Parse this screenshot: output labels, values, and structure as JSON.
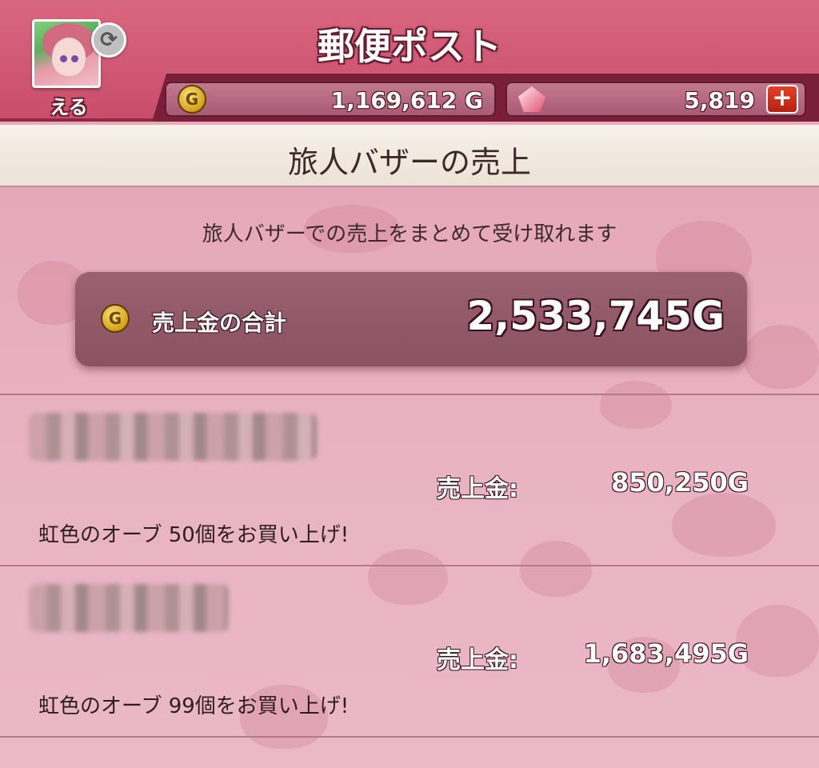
{
  "header": {
    "title": "郵便ポスト",
    "player_name": "える",
    "swap_icon": "refresh-icon",
    "gold": "1,169,612 G",
    "gems": "5,819",
    "add_gems_icon": "plus-icon"
  },
  "section": {
    "title": "旅人バザーの売上"
  },
  "main": {
    "description": "旅人バザーでの売上をまとめて受け取れます",
    "total": {
      "coin_glyph": "G",
      "label": "売上金の合計",
      "value": "2,533,745G"
    },
    "sales": [
      {
        "label": "売上金:",
        "value": "850,250G",
        "detail": "虹色のオーブ  50個をお買い上げ!"
      },
      {
        "label": "売上金:",
        "value": "1,683,495G",
        "detail": "虹色のオーブ  99個をお買い上げ!"
      }
    ]
  },
  "colors": {
    "header": "#d45e7a",
    "accent_bar": "#7a1f3a",
    "panel": "#8e5666",
    "background": "#e8a9bb"
  }
}
